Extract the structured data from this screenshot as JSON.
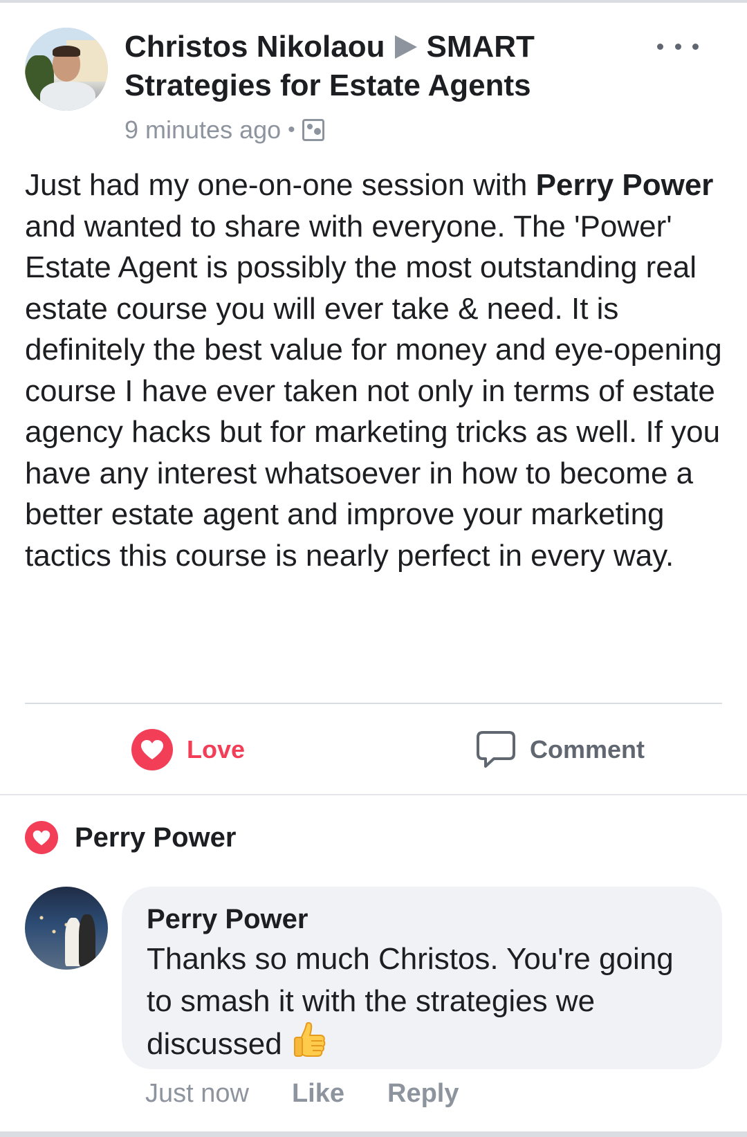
{
  "post": {
    "author": "Christos Nikolaou",
    "group": "SMART Strategies for Estate Agents",
    "time": "9 minutes ago",
    "separator": "•",
    "audience_icon": "group-icon",
    "body_segments": [
      {
        "text": "Just had my one-on-one session with ",
        "bold": false
      },
      {
        "text": "Perry Power",
        "bold": true
      },
      {
        "text": " and wanted to share with everyone. The 'Power' Estate Agent is possibly the most outstanding real estate course you will ever take & need. It is definitely the best value for money and eye-opening course I have ever taken not only in terms of estate agency hacks but for marketing tricks as well. If you have any interest whatsoever in how to become a better estate agent and improve your marketing tactics this course is nearly perfect in every way.",
        "bold": false
      }
    ]
  },
  "actions": {
    "love_label": "Love",
    "comment_label": "Comment"
  },
  "reactions": {
    "reactor": "Perry Power"
  },
  "comment": {
    "author": "Perry Power",
    "text": "Thanks so much Christos. You're going to smash it with the strategies we discussed",
    "emoji": "thumbs-up",
    "time": "Just now",
    "like_label": "Like",
    "reply_label": "Reply"
  },
  "colors": {
    "love": "#f33e58",
    "muted": "#8d949e",
    "text": "#1c1e21",
    "bubble": "#f0f2f5"
  }
}
